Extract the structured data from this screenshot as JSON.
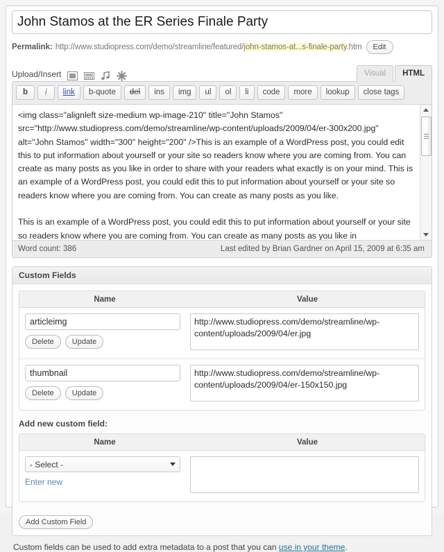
{
  "post": {
    "title": "John Stamos at the ER Series Finale Party",
    "permalink_label": "Permalink:",
    "permalink_base": "http://www.studiopress.com/demo/streamline/featured/",
    "permalink_slug": "john-stamos-at...s-finale-party",
    "permalink_ext": ".htm",
    "edit_permalink_label": "Edit"
  },
  "media": {
    "label": "Upload/Insert",
    "icons": [
      {
        "name": "insert-image-icon",
        "title": "Add an Image"
      },
      {
        "name": "insert-video-icon",
        "title": "Add Video"
      },
      {
        "name": "insert-audio-icon",
        "title": "Add Audio"
      },
      {
        "name": "insert-media-icon",
        "title": "Add Media"
      }
    ]
  },
  "editor_tabs": [
    {
      "label": "Visual",
      "active": false
    },
    {
      "label": "HTML",
      "active": true
    }
  ],
  "quicktags": [
    {
      "label": "b",
      "style": "bold"
    },
    {
      "label": "i",
      "style": "italic"
    },
    {
      "label": "link",
      "style": "link"
    },
    {
      "label": "b-quote",
      "style": "plain"
    },
    {
      "label": "del",
      "style": "del"
    },
    {
      "label": "ins",
      "style": "plain"
    },
    {
      "label": "img",
      "style": "plain"
    },
    {
      "label": "ul",
      "style": "plain"
    },
    {
      "label": "ol",
      "style": "plain"
    },
    {
      "label": "li",
      "style": "plain"
    },
    {
      "label": "code",
      "style": "plain"
    },
    {
      "label": "more",
      "style": "plain"
    },
    {
      "label": "lookup",
      "style": "plain"
    },
    {
      "label": "close tags",
      "style": "plain"
    }
  ],
  "content": {
    "html": "<img class=\"alignleft size-medium wp-image-210\" title=\"John Stamos\" src=\"http://www.studiopress.com/demo/streamline/wp-content/uploads/2009/04/er-300x200.jpg\" alt=\"John Stamos\" width=\"300\" height=\"200\" />This is an example of a WordPress post, you could edit this to put information about yourself or your site so readers know where you are coming from. You can create as many posts as you like in order to share with your readers what exactly is on your mind. This is an example of a WordPress post, you could edit this to put information about yourself or your site so readers know where you are coming from. You can create as many posts as you like.\n\nThis is an example of a WordPress post, you could edit this to put information about yourself or your site so readers know where you are coming from. You can create as many posts as you like in"
  },
  "status": {
    "word_count": "Word count: 386",
    "last_edited": "Last edited by Brian Gardner on April 15, 2009 at 6:35 am"
  },
  "custom_fields": {
    "panel_title": "Custom Fields",
    "columns": {
      "name": "Name",
      "value": "Value"
    },
    "rows": [
      {
        "name": "articleimg",
        "value": "http://www.studiopress.com/demo/streamline/wp-content/uploads/2009/04/er.jpg",
        "delete_label": "Delete",
        "update_label": "Update"
      },
      {
        "name": "thumbnail",
        "value": "http://www.studiopress.com/demo/streamline/wp-content/uploads/2009/04/er-150x150.jpg",
        "delete_label": "Delete",
        "update_label": "Update"
      }
    ],
    "add_new_label": "Add new custom field:",
    "new_field": {
      "select_value": "- Select -",
      "enter_new_label": "Enter new",
      "value": ""
    },
    "add_button_label": "Add Custom Field",
    "help_text_before": "Custom fields can be used to add extra metadata to a post that you can ",
    "help_link": "use in your theme",
    "help_text_after": "."
  },
  "colors": {
    "link": "#21759b",
    "quicktag_link": "#2a55a8",
    "slug_highlight": "#fffbcc",
    "enter_new_link": "#5a86b5"
  }
}
